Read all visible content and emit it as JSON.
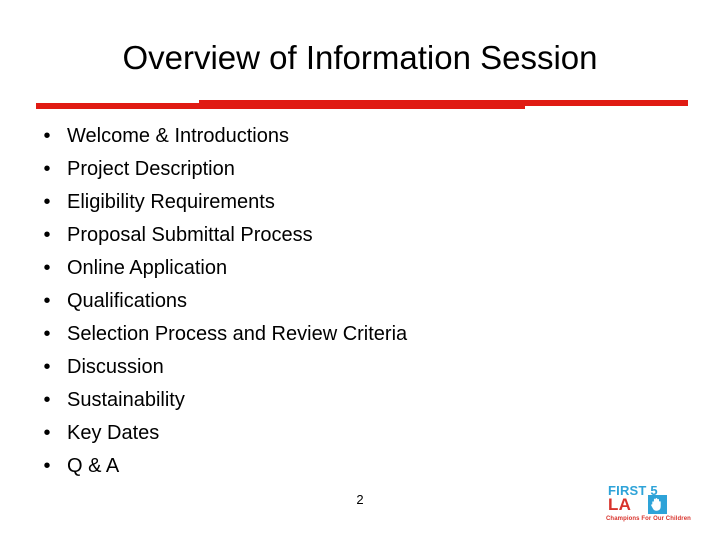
{
  "slide": {
    "title": "Overview of Information Session",
    "page_number": "2",
    "bullet_marker": "•",
    "accent_color": "#E01B13",
    "background_color": "#FFFFFF",
    "bullets": [
      {
        "label": "Welcome & Introductions"
      },
      {
        "label": "Project Description"
      },
      {
        "label": "Eligibility Requirements"
      },
      {
        "label": "Proposal Submittal Process"
      },
      {
        "label": "Online Application"
      },
      {
        "label": "Qualifications"
      },
      {
        "label": "Selection Process and Review Criteria"
      },
      {
        "label": "Discussion"
      },
      {
        "label": "Sustainability"
      },
      {
        "label": "Key Dates"
      },
      {
        "label": "Q & A"
      }
    ]
  },
  "logo": {
    "line1": "FIRST 5",
    "line2": "LA",
    "tagline": "Champions For Our Children",
    "mark_icon": "open-hand-icon",
    "blue": "#2EA3D8",
    "red": "#D8332C"
  }
}
